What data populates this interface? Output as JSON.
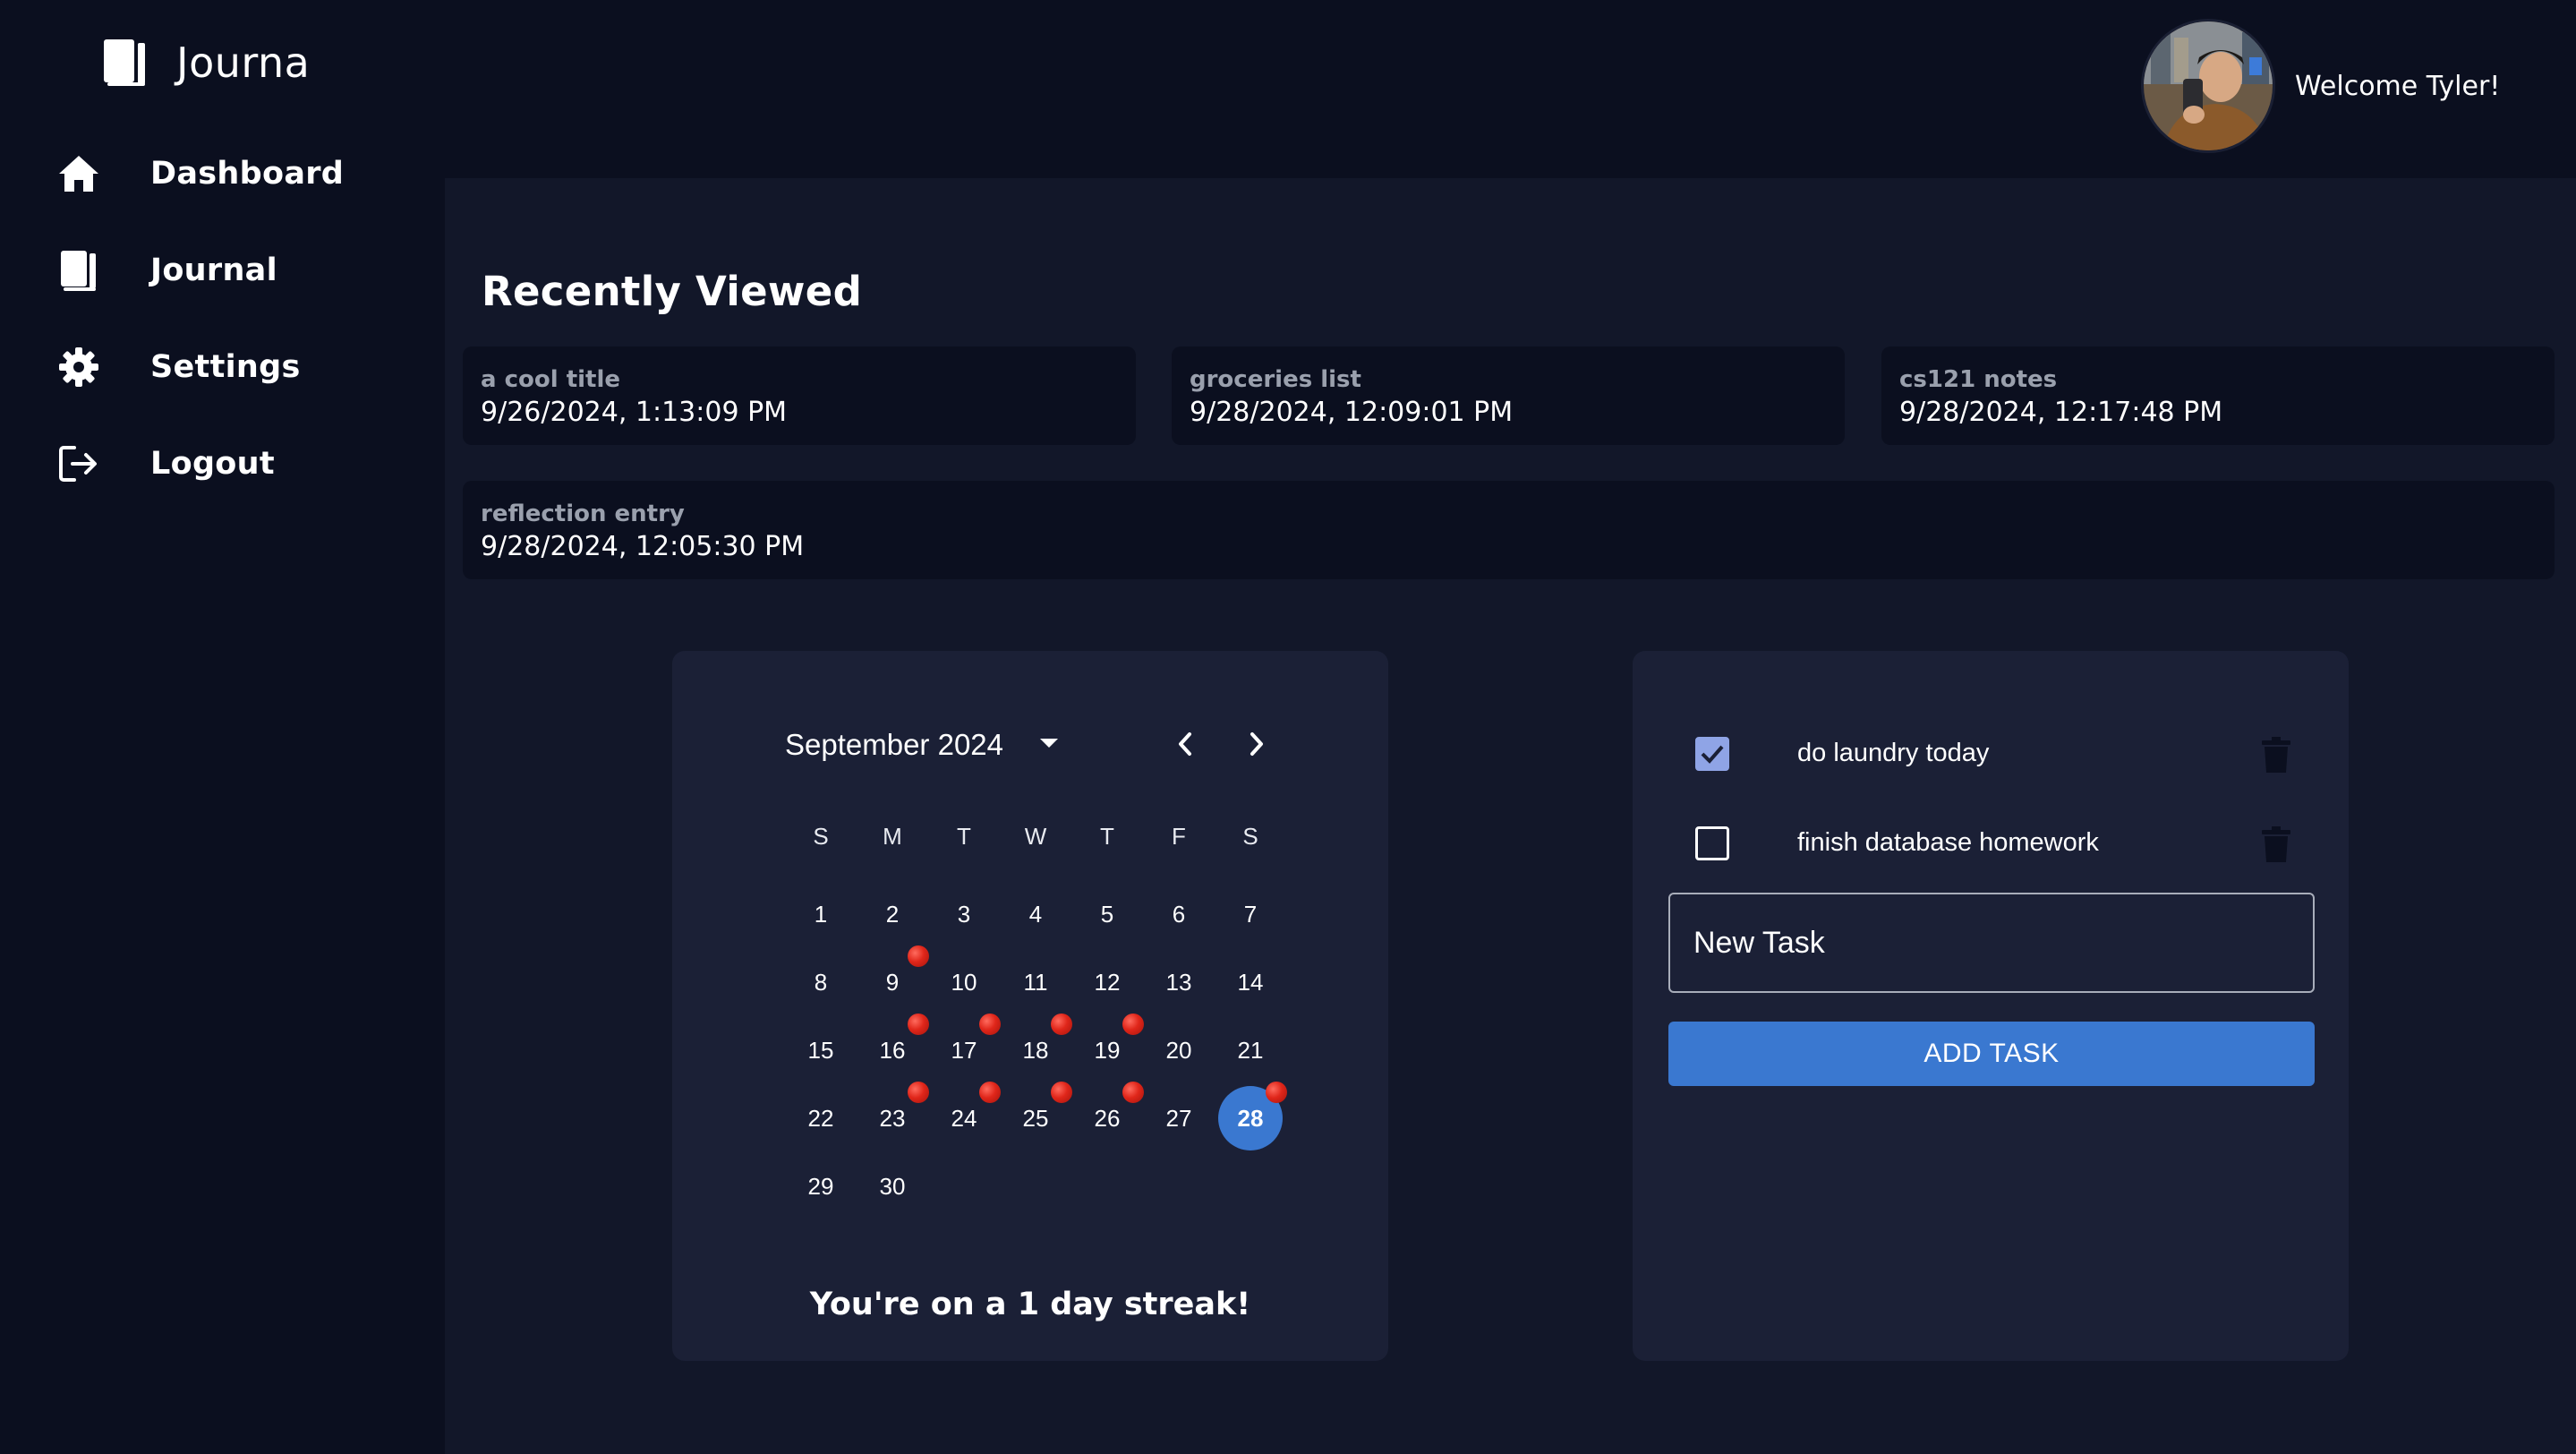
{
  "app": {
    "name": "Journa",
    "logo_icon": "book-icon"
  },
  "sidebar": {
    "items": [
      {
        "label": "Dashboard",
        "icon": "home-icon"
      },
      {
        "label": "Journal",
        "icon": "book-icon"
      },
      {
        "label": "Settings",
        "icon": "gear-icon"
      },
      {
        "label": "Logout",
        "icon": "logout-icon"
      }
    ]
  },
  "header": {
    "welcome_text": "Welcome Tyler!",
    "avatar": "user-avatar"
  },
  "recently_viewed": {
    "title": "Recently Viewed",
    "items": [
      {
        "title": "a cool title",
        "date": "9/26/2024, 1:13:09 PM"
      },
      {
        "title": "groceries list",
        "date": "9/28/2024, 12:09:01 PM"
      },
      {
        "title": "cs121 notes",
        "date": "9/28/2024, 12:17:48 PM"
      },
      {
        "title": "reflection entry",
        "date": "9/28/2024, 12:05:30 PM"
      }
    ]
  },
  "calendar": {
    "month_label": "September 2024",
    "weekdays": [
      "S",
      "M",
      "T",
      "W",
      "T",
      "F",
      "S"
    ],
    "first_weekday": 0,
    "days_in_month": 30,
    "selected_day": 28,
    "entry_days": [
      9,
      16,
      17,
      18,
      19,
      23,
      24,
      25,
      26,
      28
    ],
    "streak_text": "You're on a 1 day streak!",
    "colors": {
      "selected": "#3a78d0",
      "entry_dot": "#e0261a"
    }
  },
  "tasks": {
    "items": [
      {
        "text": "do laundry today",
        "done": true
      },
      {
        "text": "finish database homework",
        "done": false
      }
    ],
    "input_placeholder": "New Task",
    "add_label": "ADD TASK"
  },
  "colors": {
    "background": "#0b0f1f",
    "panel": "#121729",
    "card": "#1b2036",
    "accent": "#3a78d0"
  }
}
